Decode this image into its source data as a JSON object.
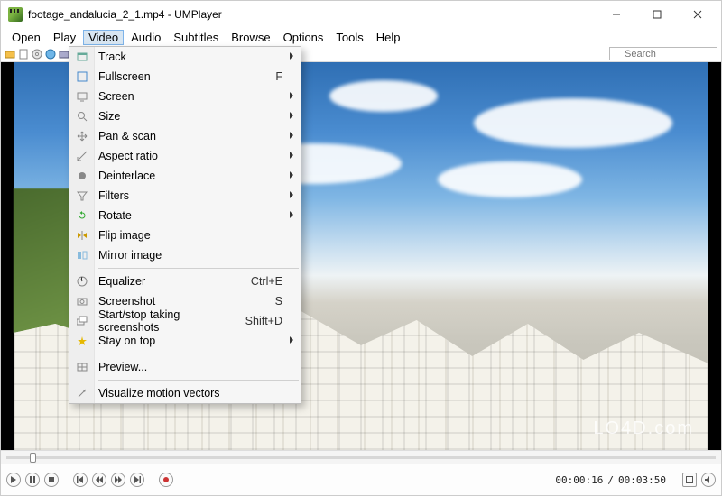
{
  "titlebar": {
    "title": "footage_andalucia_2_1.mp4 - UMPlayer"
  },
  "menubar": {
    "items": [
      "Open",
      "Play",
      "Video",
      "Audio",
      "Subtitles",
      "Browse",
      "Options",
      "Tools",
      "Help"
    ],
    "active": "Video"
  },
  "search": {
    "placeholder": "Search"
  },
  "dropdown": {
    "groups": [
      [
        {
          "label": "Track",
          "submenu": true,
          "icon": "track"
        },
        {
          "label": "Fullscreen",
          "shortcut": "F",
          "icon": "fullscreen"
        },
        {
          "label": "Screen",
          "submenu": true,
          "icon": "screen"
        },
        {
          "label": "Size",
          "submenu": true,
          "icon": "size"
        },
        {
          "label": "Pan & scan",
          "submenu": true,
          "icon": "pan"
        },
        {
          "label": "Aspect ratio",
          "submenu": true,
          "icon": "aspect"
        },
        {
          "label": "Deinterlace",
          "submenu": true,
          "icon": "deinterlace"
        },
        {
          "label": "Filters",
          "submenu": true,
          "icon": "filters"
        },
        {
          "label": "Rotate",
          "submenu": true,
          "icon": "rotate"
        },
        {
          "label": "Flip image",
          "icon": "flip"
        },
        {
          "label": "Mirror image",
          "icon": "mirror"
        }
      ],
      [
        {
          "label": "Equalizer",
          "shortcut": "Ctrl+E",
          "icon": "equalizer"
        },
        {
          "label": "Screenshot",
          "shortcut": "S",
          "icon": "screenshot"
        },
        {
          "label": "Start/stop taking screenshots",
          "shortcut": "Shift+D",
          "icon": "screenshots"
        },
        {
          "label": "Stay on top",
          "submenu": true,
          "icon": "stayontop"
        }
      ],
      [
        {
          "label": "Preview...",
          "icon": "preview"
        }
      ],
      [
        {
          "label": "Visualize motion vectors",
          "icon": "vectors"
        }
      ]
    ]
  },
  "watermark": "LO4D.com",
  "playback": {
    "current": "00:00:16",
    "total": "00:03:50",
    "separator": " / "
  }
}
